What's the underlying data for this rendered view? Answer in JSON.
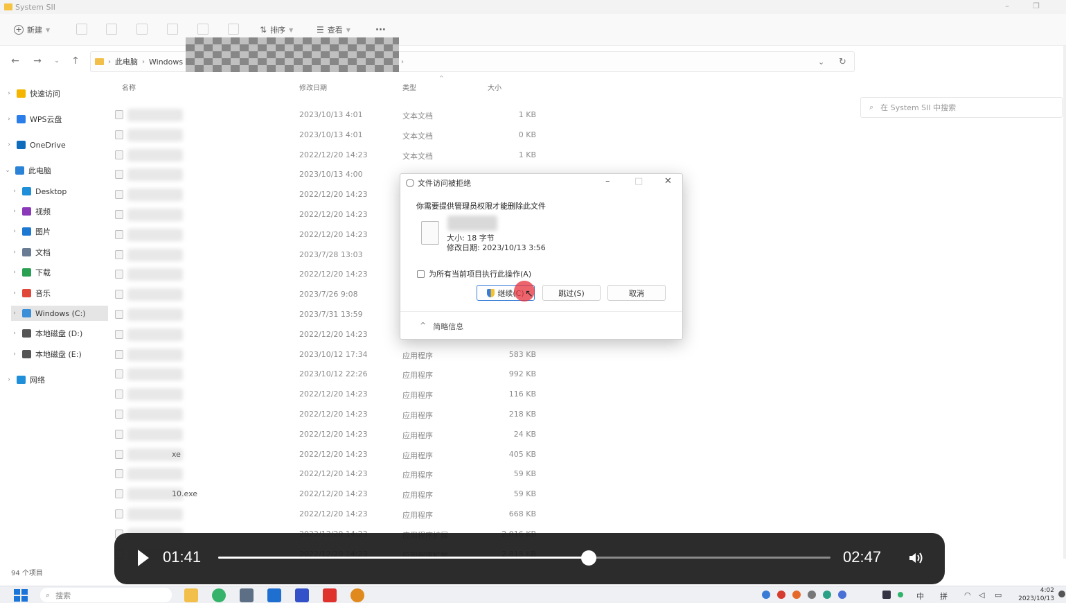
{
  "window": {
    "title": "System SII"
  },
  "toolbar": {
    "new_label": "新建",
    "sort_label": "排序",
    "view_label": "查看",
    "more_label": "···"
  },
  "address": {
    "crumb1": "此电脑",
    "crumb2": "Windows",
    "search_placeholder": "在 System SII 中搜索"
  },
  "sidebar": {
    "items": [
      {
        "label": "快速访问",
        "icon": "star-icon",
        "color": "#f4b400"
      },
      {
        "label": "WPS云盘",
        "icon": "cloud-icon",
        "color": "#2b7de9"
      },
      {
        "label": "OneDrive",
        "icon": "cloud-icon",
        "color": "#0f6cbd"
      },
      {
        "label": "此电脑",
        "icon": "computer-icon",
        "color": "#2a83d6"
      },
      {
        "label": "Desktop",
        "icon": "desktop-icon",
        "color": "#1e8fd8"
      },
      {
        "label": "视频",
        "icon": "video-icon",
        "color": "#8a3ab9"
      },
      {
        "label": "图片",
        "icon": "picture-icon",
        "color": "#1d78d2"
      },
      {
        "label": "文档",
        "icon": "document-icon",
        "color": "#6a7c93"
      },
      {
        "label": "下载",
        "icon": "download-icon",
        "color": "#2aa052"
      },
      {
        "label": "音乐",
        "icon": "music-icon",
        "color": "#e0483a"
      },
      {
        "label": "Windows (C:)",
        "icon": "drive-icon",
        "color": "#3a8fd8"
      },
      {
        "label": "本地磁盘 (D:)",
        "icon": "drive-icon",
        "color": "#555555"
      },
      {
        "label": "本地磁盘 (E:)",
        "icon": "drive-icon",
        "color": "#555555"
      },
      {
        "label": "网络",
        "icon": "network-icon",
        "color": "#1e8fd8"
      }
    ]
  },
  "columns": {
    "name": "名称",
    "date": "修改日期",
    "type": "类型",
    "size": "大小"
  },
  "rows": [
    {
      "name_tail": "",
      "date": "2023/10/13 4:01",
      "type": "文本文档",
      "size": "1 KB"
    },
    {
      "name_tail": "",
      "date": "2023/10/13 4:01",
      "type": "文本文档",
      "size": "0 KB"
    },
    {
      "name_tail": "",
      "date": "2022/12/20 14:23",
      "type": "文本文档",
      "size": "1 KB"
    },
    {
      "name_tail": "",
      "date": "2023/10/13 4:00",
      "type": "",
      "size": ""
    },
    {
      "name_tail": "",
      "date": "2022/12/20 14:23",
      "type": "",
      "size": ""
    },
    {
      "name_tail": "",
      "date": "2022/12/20 14:23",
      "type": "",
      "size": ""
    },
    {
      "name_tail": "",
      "date": "2022/12/20 14:23",
      "type": "",
      "size": ""
    },
    {
      "name_tail": "",
      "date": "2023/7/28 13:03",
      "type": "",
      "size": ""
    },
    {
      "name_tail": "",
      "date": "2022/12/20 14:23",
      "type": "",
      "size": ""
    },
    {
      "name_tail": "",
      "date": "2023/7/26 9:08",
      "type": "",
      "size": ""
    },
    {
      "name_tail": "",
      "date": "2023/7/31 13:59",
      "type": "",
      "size": ""
    },
    {
      "name_tail": "",
      "date": "2022/12/20 14:23",
      "type": "",
      "size": ""
    },
    {
      "name_tail": "",
      "date": "2023/10/12 17:34",
      "type": "应用程序",
      "size": "583 KB"
    },
    {
      "name_tail": "",
      "date": "2023/10/12 22:26",
      "type": "应用程序",
      "size": "992 KB"
    },
    {
      "name_tail": "",
      "date": "2022/12/20 14:23",
      "type": "应用程序",
      "size": "116 KB"
    },
    {
      "name_tail": "",
      "date": "2022/12/20 14:23",
      "type": "应用程序",
      "size": "218 KB"
    },
    {
      "name_tail": "",
      "date": "2022/12/20 14:23",
      "type": "应用程序",
      "size": "24 KB"
    },
    {
      "name_tail": "xe",
      "date": "2022/12/20 14:23",
      "type": "应用程序",
      "size": "405 KB"
    },
    {
      "name_tail": "",
      "date": "2022/12/20 14:23",
      "type": "应用程序",
      "size": "59 KB"
    },
    {
      "name_tail": "10.exe",
      "date": "2022/12/20 14:23",
      "type": "应用程序",
      "size": "59 KB"
    },
    {
      "name_tail": "",
      "date": "2022/12/20 14:23",
      "type": "应用程序",
      "size": "668 KB"
    },
    {
      "name_tail": "",
      "date": "2022/12/20 14:23",
      "type": "应用程序扩展",
      "size": "2,016 KB"
    },
    {
      "name_tail": "",
      "date": "2022/12/20 14:23",
      "type": "应用程序扩展",
      "size": "2,818 KB"
    }
  ],
  "status": {
    "item_count": "94 个项目"
  },
  "dialog": {
    "title": "文件访问被拒绝",
    "message": "你需要提供管理员权限才能删除此文件",
    "file_size": "大小: 18 字节",
    "file_date": "修改日期: 2023/10/13 3:56",
    "checkbox_label": "为所有当前项目执行此操作(A)",
    "continue_label": "继续(C)",
    "skip_label": "跳过(S)",
    "cancel_label": "取消",
    "details_label": "简略信息"
  },
  "player": {
    "current_time": "01:41",
    "total_time": "02:47",
    "progress_fraction": 0.6048
  },
  "taskbar": {
    "search_label": "搜索",
    "ime_label_1": "中",
    "ime_label_2": "拼",
    "time": "4:02",
    "date": "2023/10/13"
  }
}
